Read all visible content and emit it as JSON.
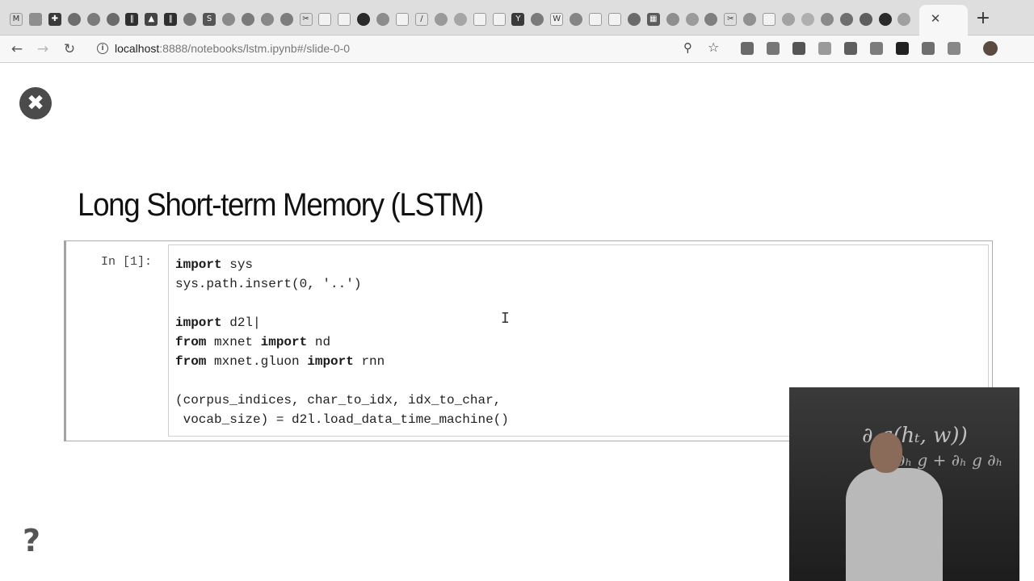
{
  "browser": {
    "address": {
      "host": "localhost",
      "rest": ":8888/notebooks/lstm.ipynb#/slide-0-0"
    },
    "tab_close_glyph": "✕",
    "new_tab_glyph": "+",
    "nav": {
      "back_glyph": "←",
      "forward_glyph": "→",
      "reload_glyph": "↻"
    },
    "tab_favicons": [
      {
        "icon": "gmail-icon",
        "glyph": "M",
        "color": "#d9d9d9",
        "light": true
      },
      {
        "icon": "doc-icon",
        "glyph": "",
        "color": "#8e8e8e"
      },
      {
        "icon": "plus-box-icon",
        "glyph": "✚",
        "color": "#3a3a3a"
      },
      {
        "icon": "circle-icon",
        "glyph": "",
        "color": "#6d6d6d"
      },
      {
        "icon": "circle-icon",
        "glyph": "",
        "color": "#7b7b7b"
      },
      {
        "icon": "circle-icon",
        "glyph": "",
        "color": "#6b6b6b"
      },
      {
        "icon": "bars-icon",
        "glyph": "‖",
        "color": "#2f2f2f"
      },
      {
        "icon": "cap-icon",
        "glyph": "▲",
        "color": "#444444"
      },
      {
        "icon": "bars-icon",
        "glyph": "‖",
        "color": "#2f2f2f"
      },
      {
        "icon": "circle-icon",
        "glyph": "",
        "color": "#777777"
      },
      {
        "icon": "s-icon",
        "glyph": "S",
        "color": "#555555"
      },
      {
        "icon": "circle-icon",
        "glyph": "",
        "color": "#8a8a8a"
      },
      {
        "icon": "circle-icon",
        "glyph": "",
        "color": "#7a7a7a"
      },
      {
        "icon": "circle-icon",
        "glyph": "",
        "color": "#888888"
      },
      {
        "icon": "circle-icon",
        "glyph": "",
        "color": "#7d7d7d"
      },
      {
        "icon": "tool-icon",
        "glyph": "✂",
        "color": "#dedede",
        "light": true
      },
      {
        "icon": "page-icon",
        "glyph": "",
        "color": "#f2f2f2",
        "light": true
      },
      {
        "icon": "page-icon",
        "glyph": "",
        "color": "#f2f2f2",
        "light": true
      },
      {
        "icon": "github-icon",
        "glyph": "",
        "color": "#2a2a2a"
      },
      {
        "icon": "circle-icon",
        "glyph": "",
        "color": "#8c8c8c"
      },
      {
        "icon": "page-icon",
        "glyph": "",
        "color": "#f2f2f2",
        "light": true
      },
      {
        "icon": "pen-icon",
        "glyph": "/",
        "color": "#e4e4e4",
        "light": true
      },
      {
        "icon": "circle-icon",
        "glyph": "",
        "color": "#9a9a9a"
      },
      {
        "icon": "circle-icon",
        "glyph": "",
        "color": "#a5a5a5"
      },
      {
        "icon": "page-icon",
        "glyph": "",
        "color": "#f2f2f2",
        "light": true
      },
      {
        "icon": "page-icon",
        "glyph": "",
        "color": "#f2f2f2",
        "light": true
      },
      {
        "icon": "y-icon",
        "glyph": "Y",
        "color": "#3a3a3a"
      },
      {
        "icon": "circle-icon",
        "glyph": "",
        "color": "#7a7a7a"
      },
      {
        "icon": "wikipedia-icon",
        "glyph": "W",
        "color": "#efefef",
        "light": true
      },
      {
        "icon": "circle-icon",
        "glyph": "",
        "color": "#858585"
      },
      {
        "icon": "page-icon",
        "glyph": "",
        "color": "#f2f2f2",
        "light": true
      },
      {
        "icon": "page-icon",
        "glyph": "",
        "color": "#f2f2f2",
        "light": true
      },
      {
        "icon": "circle-icon",
        "glyph": "",
        "color": "#6a6a6a"
      },
      {
        "icon": "grid-icon",
        "glyph": "▦",
        "color": "#5b5b5b"
      },
      {
        "icon": "circle-icon",
        "glyph": "",
        "color": "#8f8f8f"
      },
      {
        "icon": "circle-icon",
        "glyph": "",
        "color": "#9b9b9b"
      },
      {
        "icon": "circle-icon",
        "glyph": "",
        "color": "#7f7f7f"
      },
      {
        "icon": "tool-icon",
        "glyph": "✂",
        "color": "#dedede",
        "light": true
      },
      {
        "icon": "circle-icon",
        "glyph": "",
        "color": "#909090"
      },
      {
        "icon": "page-icon",
        "glyph": "",
        "color": "#f2f2f2",
        "light": true
      },
      {
        "icon": "circle-icon",
        "glyph": "",
        "color": "#a2a2a2"
      },
      {
        "icon": "circle-icon",
        "glyph": "",
        "color": "#b0b0b0"
      },
      {
        "icon": "circle-icon",
        "glyph": "",
        "color": "#8a8a8a"
      },
      {
        "icon": "circle-icon",
        "glyph": "",
        "color": "#6e6e6e"
      },
      {
        "icon": "circle-icon",
        "glyph": "",
        "color": "#5e5e5e"
      },
      {
        "icon": "github-icon",
        "glyph": "",
        "color": "#2a2a2a"
      },
      {
        "icon": "circle-icon",
        "glyph": "",
        "color": "#a0a0a0"
      }
    ],
    "toolbar_icons": [
      {
        "icon": "zoom-icon",
        "glyph": "⚲"
      },
      {
        "icon": "bookmark-star-icon",
        "glyph": "☆"
      }
    ],
    "extension_icons": [
      {
        "icon": "extension-circle-icon",
        "color": "#6a6a6a"
      },
      {
        "icon": "extension-diamond-icon",
        "color": "#777777"
      },
      {
        "icon": "pocket-icon",
        "color": "#555555"
      },
      {
        "icon": "extension-cloud-icon",
        "color": "#9a9a9a"
      },
      {
        "icon": "extension-grid-icon",
        "color": "#5f5f5f"
      },
      {
        "icon": "camera-icon",
        "color": "#7c7c7c"
      },
      {
        "icon": "extension-face-icon",
        "color": "#222222"
      },
      {
        "icon": "extension-puzzle-icon",
        "color": "#6f6f6f"
      },
      {
        "icon": "extension-aa-icon",
        "color": "#888888"
      },
      {
        "icon": "profile-avatar-icon",
        "color": "#5a4a40"
      }
    ]
  },
  "slide": {
    "close_glyph": "✖",
    "title": "Long Short-term Memory (LSTM)",
    "cell": {
      "prompt": "In [1]:",
      "code_lines": [
        [
          {
            "t": "import",
            "kw": true
          },
          {
            "t": " sys"
          }
        ],
        [
          {
            "t": "sys.path.insert(0, '..')"
          }
        ],
        [],
        [
          {
            "t": "import",
            "kw": true
          },
          {
            "t": " d2l|"
          }
        ],
        [
          {
            "t": "from",
            "kw": true
          },
          {
            "t": " mxnet "
          },
          {
            "t": "import",
            "kw": true
          },
          {
            "t": " nd"
          }
        ],
        [
          {
            "t": "from",
            "kw": true
          },
          {
            "t": " mxnet.gluon "
          },
          {
            "t": "import",
            "kw": true
          },
          {
            "t": " rnn"
          }
        ],
        [],
        [
          {
            "t": "(corpus_indices, char_to_idx, idx_to_char,"
          }
        ],
        [
          {
            "t": " vocab_size) = d2l.load_data_time_machine()"
          }
        ]
      ]
    },
    "cursor_glyph": "I",
    "help_glyph": "?"
  },
  "video": {
    "board_line1": "∂  g(hₜ, w))",
    "board_line2": "= ∂ₕ g + ∂ₕ g ∂ₕ"
  }
}
